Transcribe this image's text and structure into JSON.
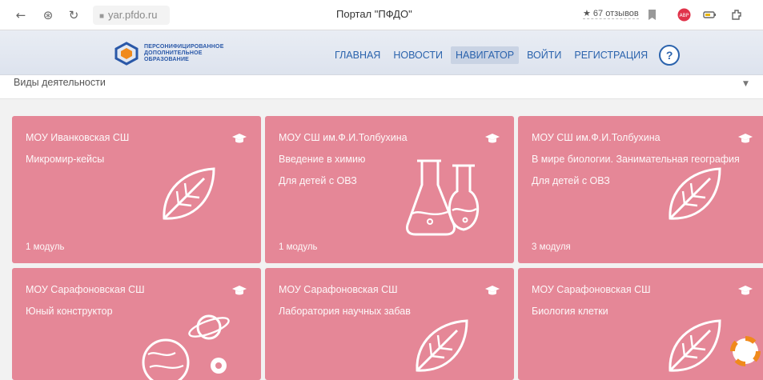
{
  "browser": {
    "url": "yar.pfdo.ru",
    "title": "Портал \"ПФДО\"",
    "reviews": "★ 67 отзывов",
    "icons": [
      "back-icon",
      "privacy-icon",
      "reload-icon",
      "lock-icon",
      "bookmark-icon",
      "adblock-icon",
      "battery-icon",
      "extension-icon"
    ]
  },
  "header": {
    "logo_lines": [
      "ПЕРСОНИФИЦИРОВАННОЕ",
      "ДОПОЛНИТЕЛЬНОЕ",
      "ОБРАЗОВАНИЕ"
    ],
    "menu": [
      {
        "label": "ГЛАВНАЯ",
        "active": false
      },
      {
        "label": "НОВОСТИ",
        "active": false
      },
      {
        "label": "НАВИГАТОР",
        "active": true
      },
      {
        "label": "ВОЙТИ",
        "active": false
      },
      {
        "label": "РЕГИСТРАЦИЯ",
        "active": false
      }
    ],
    "help_label": "?"
  },
  "filter": {
    "label": "Виды деятельности",
    "caret": "▼"
  },
  "colors": {
    "card": "#e58797",
    "menu_text": "#2b63ad"
  },
  "cards": [
    {
      "org": "МОУ Иванковская СШ",
      "course": "Микромир-кейсы",
      "note": "",
      "modules": "1 модуль",
      "icon": "leaf-icon"
    },
    {
      "org": "МОУ СШ им.Ф.И.Толбухина",
      "course": "Введение в химию",
      "note": "Для детей с ОВЗ",
      "modules": "1 модуль",
      "icon": "flasks-icon"
    },
    {
      "org": "МОУ СШ им.Ф.И.Толбухина",
      "course": "В мире биологии. Занимательная география",
      "note": "Для детей с ОВЗ",
      "modules": "3 модуля",
      "icon": "leaf-icon"
    },
    {
      "org": "МОУ Сарафоновская СШ",
      "course": "Юный конструктор",
      "note": "",
      "modules": "",
      "icon": "planets-icon"
    },
    {
      "org": "МОУ Сарафоновская СШ",
      "course": "Лаборатория научных забав",
      "note": "",
      "modules": "",
      "icon": "leaf-icon"
    },
    {
      "org": "МОУ Сарафоновская СШ",
      "course": "Биология клетки",
      "note": "",
      "modules": "",
      "icon": "leaf-icon"
    }
  ]
}
